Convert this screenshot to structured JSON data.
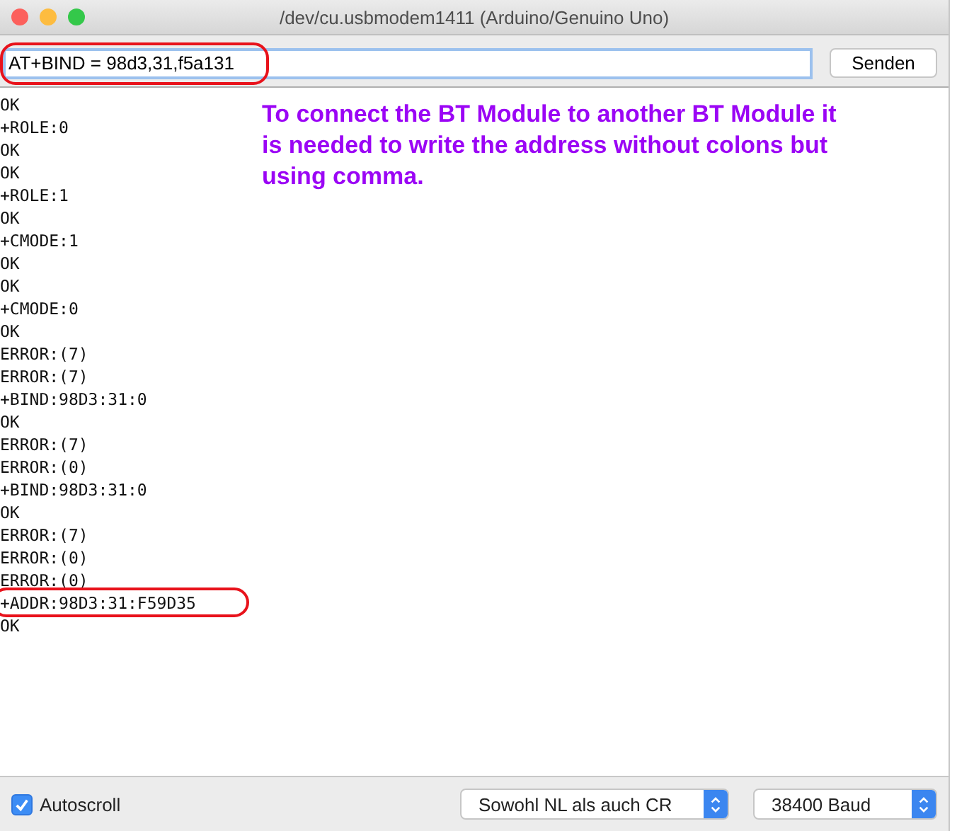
{
  "window": {
    "title": "/dev/cu.usbmodem1411 (Arduino/Genuino Uno)"
  },
  "input": {
    "value": "AT+BIND = 98d3,31,f5a131",
    "highlighted": true
  },
  "send_button": "Senden",
  "log": [
    {
      "text": "OK",
      "highlighted": false
    },
    {
      "text": "+ROLE:0",
      "highlighted": false
    },
    {
      "text": "OK",
      "highlighted": false
    },
    {
      "text": "OK",
      "highlighted": false
    },
    {
      "text": "+ROLE:1",
      "highlighted": false
    },
    {
      "text": "OK",
      "highlighted": false
    },
    {
      "text": "+CMODE:1",
      "highlighted": false
    },
    {
      "text": "OK",
      "highlighted": false
    },
    {
      "text": "OK",
      "highlighted": false
    },
    {
      "text": "+CMODE:0",
      "highlighted": false
    },
    {
      "text": "OK",
      "highlighted": false
    },
    {
      "text": "ERROR:(7)",
      "highlighted": false
    },
    {
      "text": "ERROR:(7)",
      "highlighted": false
    },
    {
      "text": "+BIND:98D3:31:0",
      "highlighted": false
    },
    {
      "text": "OK",
      "highlighted": false
    },
    {
      "text": "ERROR:(7)",
      "highlighted": false
    },
    {
      "text": "ERROR:(0)",
      "highlighted": false
    },
    {
      "text": "+BIND:98D3:31:0",
      "highlighted": false
    },
    {
      "text": "OK",
      "highlighted": false
    },
    {
      "text": "ERROR:(7)",
      "highlighted": false
    },
    {
      "text": "ERROR:(0)",
      "highlighted": false
    },
    {
      "text": "ERROR:(0)",
      "highlighted": false
    },
    {
      "text": "+ADDR:98D3:31:F59D35",
      "highlighted": true
    },
    {
      "text": "OK",
      "highlighted": false
    }
  ],
  "annotation": "To connect the BT Module to another BT Module it is needed to write the address without colons but using comma.",
  "autoscroll": {
    "label": "Autoscroll",
    "checked": true
  },
  "line_ending": "Sowohl NL als auch CR",
  "baud_rate": "38400 Baud"
}
